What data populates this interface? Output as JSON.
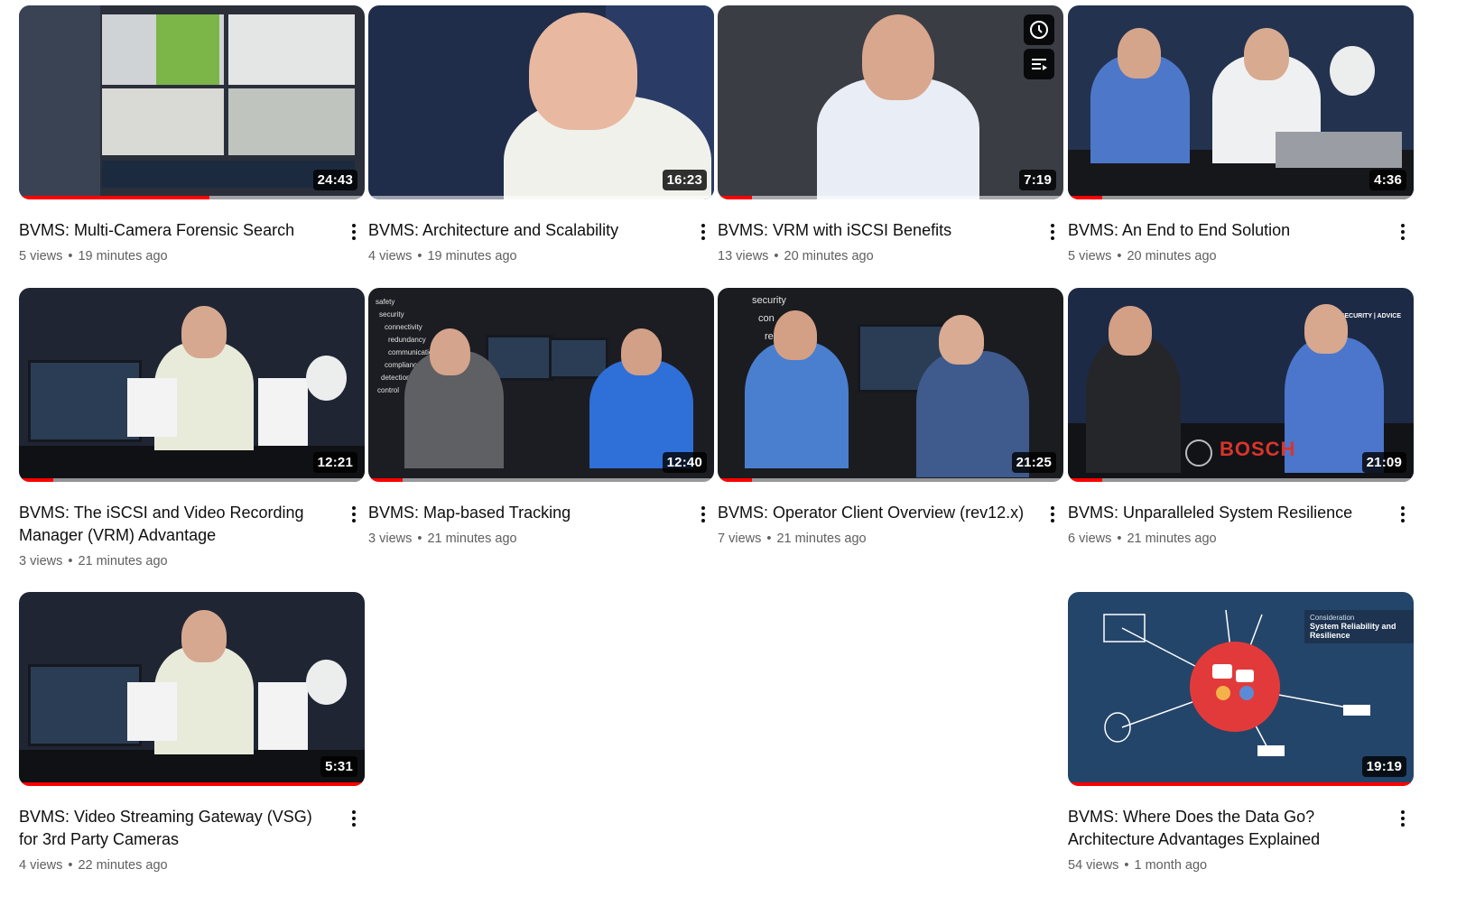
{
  "videos": [
    {
      "title": "BVMS: Multi-Camera Forensic Search",
      "views": "5 views",
      "age": "19 minutes ago",
      "duration": "24:43",
      "progress": 0.55
    },
    {
      "title": "BVMS: Architecture and Scalability",
      "views": "4 views",
      "age": "19 minutes ago",
      "duration": "16:23",
      "progress": 0.0
    },
    {
      "title": "BVMS: VRM with iSCSI Benefits",
      "views": "13 views",
      "age": "20 minutes ago",
      "duration": "7:19",
      "progress": 0.1
    },
    {
      "title": "BVMS: An End to End Solution",
      "views": "5 views",
      "age": "20 minutes ago",
      "duration": "4:36",
      "progress": 0.1
    },
    {
      "title": "BVMS: The iSCSI and Video Recording Manager (VRM) Advantage",
      "views": "3 views",
      "age": "21 minutes ago",
      "duration": "12:21",
      "progress": 0.1
    },
    {
      "title": "BVMS: Map-based Tracking",
      "views": "3 views",
      "age": "21 minutes ago",
      "duration": "12:40",
      "progress": 0.1
    },
    {
      "title": "BVMS: Operator Client Overview (rev12.x)",
      "views": "7 views",
      "age": "21 minutes ago",
      "duration": "21:25",
      "progress": 0.1
    },
    {
      "title": "BVMS: Unparalleled System Resilience",
      "views": "6 views",
      "age": "21 minutes ago",
      "duration": "21:09",
      "progress": 0.1
    },
    {
      "title": "BVMS: Video Streaming Gateway (VSG) for 3rd Party Cameras",
      "views": "4 views",
      "age": "22 minutes ago",
      "duration": "5:31",
      "progress": 1.0
    },
    {
      "title": "BVMS: Where Does the Data Go? Architecture Advantages Explained",
      "views": "54 views",
      "age": "1 month ago",
      "duration": "19:19",
      "progress": 1.0
    }
  ],
  "thumb_text": {
    "bosch": "BOSCH",
    "security_advice": "SECURITY | ADVICE",
    "consideration": "Consideration",
    "system_reliability": "System Reliability and Resilience",
    "words_map": [
      "safety",
      "security",
      "connectivity",
      "redundancy",
      "communication",
      "compliance",
      "detection",
      "control"
    ],
    "words_op": [
      "security",
      "con",
      "re"
    ]
  },
  "hover_icons": [
    "clock-icon",
    "add-to-queue-icon"
  ],
  "colors": {
    "progress": "#ff0000",
    "meta": "#606060",
    "title": "#0f0f0f"
  }
}
